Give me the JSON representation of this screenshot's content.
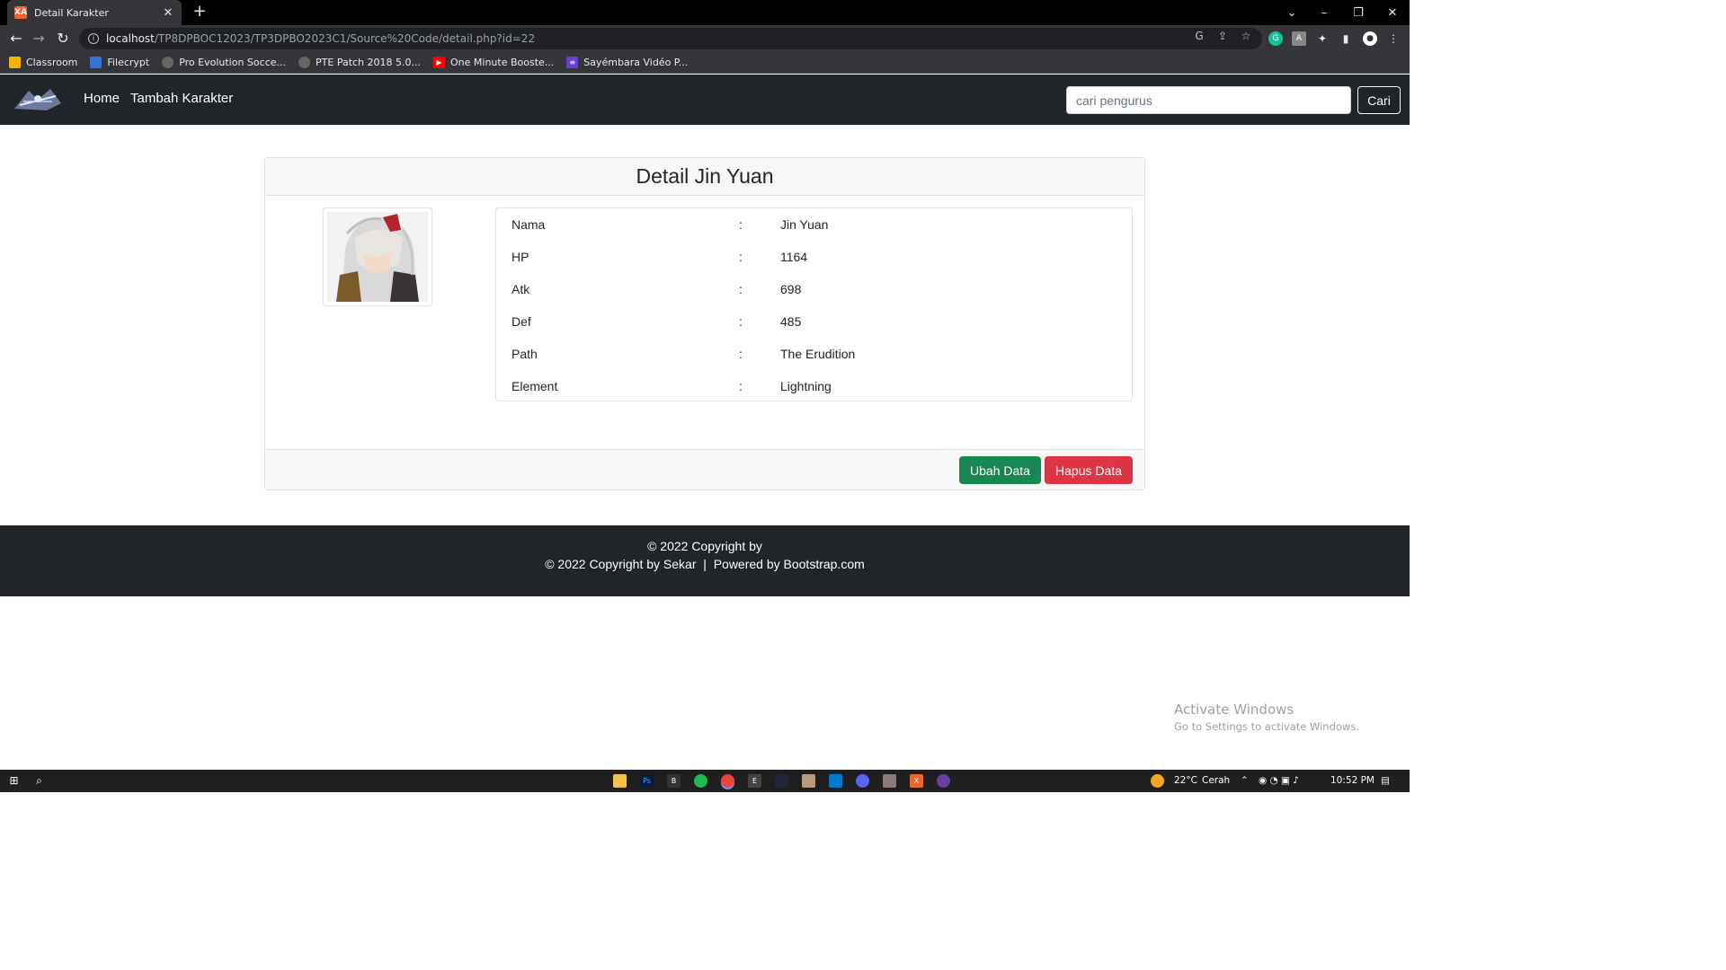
{
  "browser": {
    "tab_title": "Detail Karakter",
    "tab_favicon_letter": "XA",
    "url_host": "localhost",
    "url_path": "/TP8DPBOC12023/TP3DPBO2023C1/Source%20Code/detail.php?id=22",
    "bookmarks": [
      {
        "label": "Classroom",
        "color": "#f4b400"
      },
      {
        "label": "Filecrypt",
        "color": "#3b6fd8"
      },
      {
        "label": "Pro Evolution Socce...",
        "color": "#666666"
      },
      {
        "label": "PTE Patch 2018 5.0...",
        "color": "#666666"
      },
      {
        "label": "One Minute Booste...",
        "color": "#ff0000"
      },
      {
        "label": "Sayémbara Vidéo P...",
        "color": "#6a3fd4"
      }
    ]
  },
  "navbar": {
    "links": [
      "Home",
      "Tambah Karakter"
    ],
    "search_placeholder": "cari pengurus",
    "search_button": "Cari"
  },
  "card": {
    "title": "Detail Jin Yuan",
    "fields": [
      {
        "label": "Nama",
        "sep": ":",
        "value": "Jin Yuan"
      },
      {
        "label": "HP",
        "sep": ":",
        "value": "1164"
      },
      {
        "label": "Atk",
        "sep": ":",
        "value": "698"
      },
      {
        "label": "Def",
        "sep": ":",
        "value": "485"
      },
      {
        "label": "Path",
        "sep": ":",
        "value": "The Erudition"
      },
      {
        "label": "Element",
        "sep": ":",
        "value": "Lightning"
      }
    ],
    "edit_button": "Ubah Data",
    "delete_button": "Hapus Data"
  },
  "footer": {
    "line1": "© 2022 Copyright by",
    "line2": "© 2022 Copyright by Sekar  |  Powered by Bootstrap.com"
  },
  "watermark": {
    "title": "Activate Windows",
    "subtitle": "Go to Settings to activate Windows."
  },
  "taskbar": {
    "weather": "22°C",
    "weather_desc": "Cerah",
    "time": "10:52 PM"
  },
  "colors": {
    "navbar_bg": "#212529",
    "edit_button": "#198754",
    "delete_button": "#dc3545"
  }
}
